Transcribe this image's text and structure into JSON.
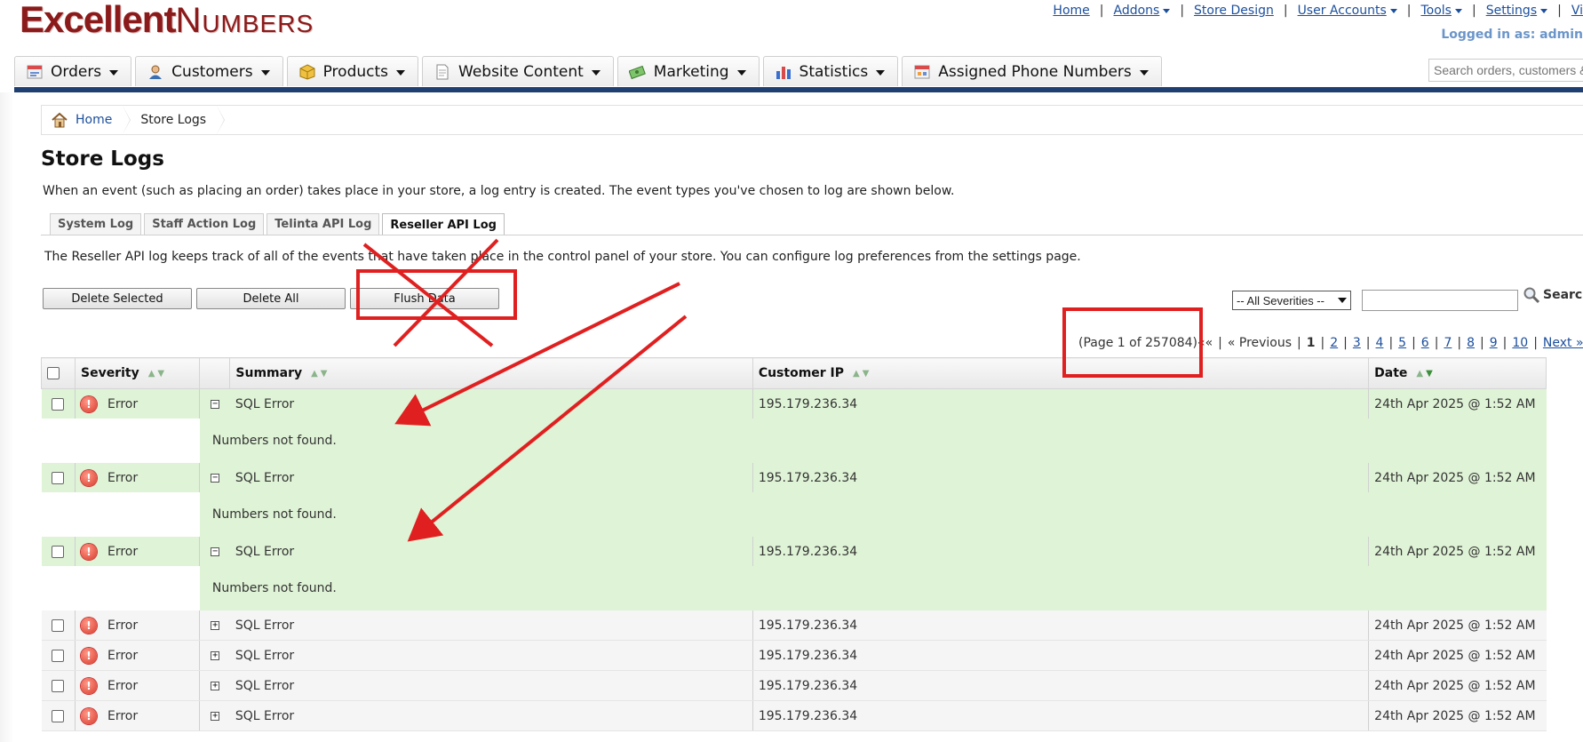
{
  "brand": {
    "part1": "Excellent",
    "part2": "Numbers"
  },
  "toplinks": [
    {
      "label": "Home",
      "dropdown": false
    },
    {
      "label": "Addons",
      "dropdown": true
    },
    {
      "label": "Store Design",
      "dropdown": false
    },
    {
      "label": "User Accounts",
      "dropdown": true
    },
    {
      "label": "Tools",
      "dropdown": true
    },
    {
      "label": "Settings",
      "dropdown": true
    },
    {
      "label": "Vi",
      "dropdown": false
    }
  ],
  "logged_in": "Logged in as: admin",
  "menu": [
    {
      "label": "Orders",
      "icon": "orders-icon"
    },
    {
      "label": "Customers",
      "icon": "customers-icon"
    },
    {
      "label": "Products",
      "icon": "products-icon"
    },
    {
      "label": "Website Content",
      "icon": "website-content-icon"
    },
    {
      "label": "Marketing",
      "icon": "marketing-icon"
    },
    {
      "label": "Statistics",
      "icon": "statistics-icon"
    },
    {
      "label": "Assigned Phone Numbers",
      "icon": "phone-numbers-icon"
    }
  ],
  "search": {
    "placeholder": "Search orders, customers & p"
  },
  "breadcrumb": {
    "home": "Home",
    "current": "Store Logs"
  },
  "page": {
    "title": "Store Logs",
    "intro": "When an event (such as placing an order) takes place in your store, a log entry is created. The event types you've chosen to log are shown below.",
    "description": "The Reseller API log keeps track of all of the events that have taken place in the control panel of your store. You can configure log preferences from the settings page."
  },
  "subtabs": [
    "System Log",
    "Staff Action Log",
    "Telinta API Log",
    "Reseller API Log"
  ],
  "active_subtab": "Reseller API Log",
  "buttons": {
    "delete_selected": "Delete Selected",
    "delete_all": "Delete All",
    "flush_data": "Flush Data"
  },
  "filters": {
    "severity_selected": "-- All Severities --",
    "search_label": "Search"
  },
  "pagination": {
    "info": "(Page 1 of 257084)",
    "first": "««",
    "previous": "« Previous",
    "current": "1",
    "pages": [
      "2",
      "3",
      "4",
      "5",
      "6",
      "7",
      "8",
      "9",
      "10"
    ],
    "next": "Next »",
    "last": "»"
  },
  "table": {
    "headers": {
      "severity": "Severity",
      "summary": "Summary",
      "customer_ip": "Customer IP",
      "date": "Date"
    },
    "rows": [
      {
        "severity": "Error",
        "summary": "SQL Error",
        "ip": "195.179.236.34",
        "date": "24th Apr 2025 @ 1:52 AM",
        "expanded": true,
        "detail": "Numbers not found."
      },
      {
        "severity": "Error",
        "summary": "SQL Error",
        "ip": "195.179.236.34",
        "date": "24th Apr 2025 @ 1:52 AM",
        "expanded": true,
        "detail": "Numbers not found."
      },
      {
        "severity": "Error",
        "summary": "SQL Error",
        "ip": "195.179.236.34",
        "date": "24th Apr 2025 @ 1:52 AM",
        "expanded": true,
        "detail": "Numbers not found."
      },
      {
        "severity": "Error",
        "summary": "SQL Error",
        "ip": "195.179.236.34",
        "date": "24th Apr 2025 @ 1:52 AM",
        "expanded": false
      },
      {
        "severity": "Error",
        "summary": "SQL Error",
        "ip": "195.179.236.34",
        "date": "24th Apr 2025 @ 1:52 AM",
        "expanded": false
      },
      {
        "severity": "Error",
        "summary": "SQL Error",
        "ip": "195.179.236.34",
        "date": "24th Apr 2025 @ 1:52 AM",
        "expanded": false
      },
      {
        "severity": "Error",
        "summary": "SQL Error",
        "ip": "195.179.236.34",
        "date": "24th Apr 2025 @ 1:52 AM",
        "expanded": false
      }
    ]
  },
  "colors": {
    "brand": "#8b1a1a",
    "link": "#1c4f9c",
    "nav_bar": "#1f3f73",
    "row_open": "#dff3d6",
    "annotation": "#e02020"
  }
}
